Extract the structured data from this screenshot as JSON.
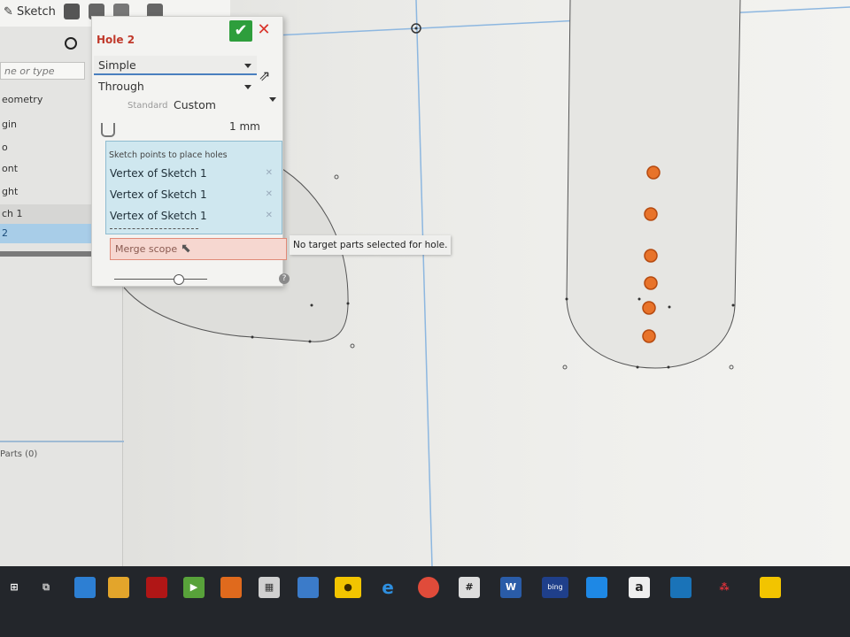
{
  "toolbar": {
    "sketch_label": "Sketch"
  },
  "feature_tree": {
    "filter_placeholder": "ne or type",
    "items": [
      "eometry",
      "gin",
      "o",
      "ont",
      "ght",
      "ch 1",
      "2"
    ],
    "parts_label": "Parts (0)"
  },
  "hole_dialog": {
    "title": "Hole 2",
    "style": "Simple",
    "termination": "Through",
    "standard_label": "Standard",
    "standard_value": "Custom",
    "depth": "1 mm",
    "points_label": "Sketch points to place holes",
    "points": [
      "Vertex of Sketch 1",
      "Vertex of Sketch 1",
      "Vertex of Sketch 1"
    ],
    "merge_scope_label": "Merge scope"
  },
  "tooltip": {
    "text": "No target parts selected for hole."
  },
  "taskbar": {
    "word_label": "W",
    "amazon_label": "a",
    "hash_label": "#",
    "bing_label": "bing"
  },
  "colors": {
    "accent": "#2e9e3c",
    "error": "#d9342b",
    "hole_fill": "#e8732a",
    "sketch_line": "#8db7e0",
    "selection": "#a8cde8"
  }
}
